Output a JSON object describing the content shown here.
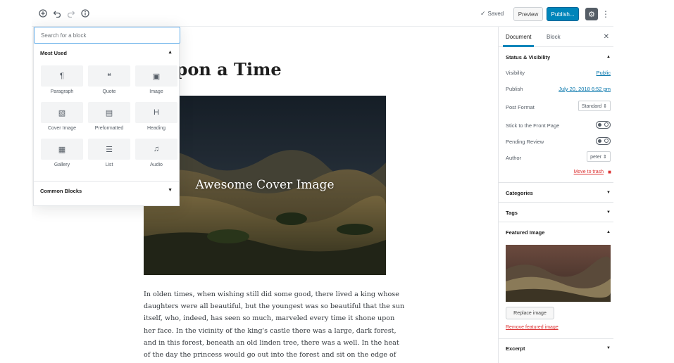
{
  "toolbar": {
    "inserter_icon": "plus-circle-icon",
    "undo_icon": "undo-icon",
    "redo_icon": "redo-icon",
    "info_icon": "info-icon",
    "saved_label": "Saved",
    "preview_label": "Preview",
    "publish_label": "Publish...",
    "settings_icon": "gear-icon",
    "more_icon": "more-vertical-icon"
  },
  "inserter": {
    "search_placeholder": "Search for a block",
    "most_used_title": "Most Used",
    "common_blocks_title": "Common Blocks",
    "blocks": [
      {
        "label": "Paragraph",
        "glyph": "¶",
        "icon": "paragraph-icon"
      },
      {
        "label": "Quote",
        "glyph": "❝",
        "icon": "quote-icon"
      },
      {
        "label": "Image",
        "glyph": "▣",
        "icon": "image-icon"
      },
      {
        "label": "Cover Image",
        "glyph": "▧",
        "icon": "cover-image-icon"
      },
      {
        "label": "Preformatted",
        "glyph": "▤",
        "icon": "preformatted-icon"
      },
      {
        "label": "Heading",
        "glyph": "H",
        "icon": "heading-icon"
      },
      {
        "label": "Gallery",
        "glyph": "▦",
        "icon": "gallery-icon"
      },
      {
        "label": "List",
        "glyph": "☰",
        "icon": "list-icon"
      },
      {
        "label": "Audio",
        "glyph": "♫",
        "icon": "audio-icon"
      }
    ]
  },
  "editor": {
    "title": "e Upon a Time",
    "cover_caption": "Awesome Cover Image",
    "paragraph_lines": [
      "In olden times, when wishing still did some good, there lived a king whose",
      "daughters were all beautiful, but the youngest was so beautiful that the sun",
      "itself, who, indeed, has seen so much, marveled every time it shone upon",
      "her face. In the vicinity of the king's castle there was a large, dark forest,",
      "and in this forest, beneath an old linden tree, there was a well. In the heat",
      "of the day the princess would go out into the forest and sit on the edge of"
    ]
  },
  "sidebar": {
    "tab_document": "Document",
    "tab_block": "Block",
    "close_icon": "close-icon",
    "status_visibility": {
      "title": "Status & Visibility",
      "visibility_label": "Visibility",
      "visibility_value": "Public",
      "publish_label": "Publish",
      "publish_value": "July 20, 2018 6:52 pm",
      "post_format_label": "Post Format",
      "post_format_value": "Standard ⇕",
      "sticky_label": "Stick to the Front Page",
      "pending_label": "Pending Review",
      "author_label": "Author",
      "author_value": "peter ⇕",
      "trash_label": "Move to trash",
      "trash_icon": "trash-icon"
    },
    "categories_title": "Categories",
    "tags_title": "Tags",
    "featured_image_title": "Featured Image",
    "replace_image_label": "Replace image",
    "remove_image_label": "Remove featured image",
    "excerpt_title": "Excerpt"
  }
}
